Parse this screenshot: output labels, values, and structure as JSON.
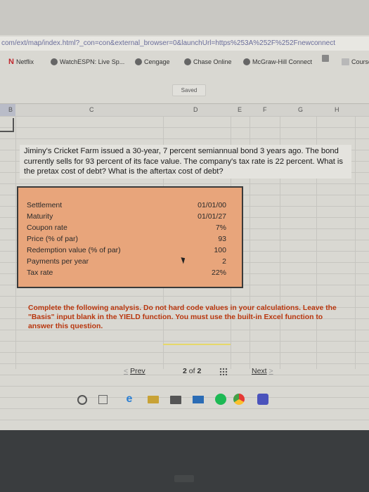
{
  "browser": {
    "url": "com/ext/map/index.html?_con=con&external_browser=0&launchUrl=https%253A%252F%252Fnewconnect",
    "bookmarks": [
      {
        "label": "Netflix",
        "icon": "netflix-icon"
      },
      {
        "label": "WatchESPN: Live Sp...",
        "icon": "globe-icon"
      },
      {
        "label": "Cengage",
        "icon": "globe-icon"
      },
      {
        "label": "Chase Online",
        "icon": "globe-icon"
      },
      {
        "label": "McGraw-Hill Connect",
        "icon": "globe-icon"
      },
      {
        "label": "",
        "icon": "mcgraw-hill-icon"
      },
      {
        "label": "Course H",
        "icon": "course-icon"
      }
    ]
  },
  "spreadsheet": {
    "status": "Saved",
    "columns": [
      "B",
      "C",
      "D",
      "E",
      "F",
      "G",
      "H"
    ]
  },
  "question": {
    "text": "Jiminy's Cricket Farm issued a 30-year, 7 percent semiannual bond 3 years ago. The bond currently sells for 93 percent of its face value. The company's tax rate is 22 percent. What is the pretax cost of debt? What is the aftertax cost of debt?"
  },
  "data_table": {
    "rows": [
      {
        "label": "Settlement",
        "value": "01/01/00"
      },
      {
        "label": "Maturity",
        "value": "01/01/27"
      },
      {
        "label": "Coupon rate",
        "value": "7%"
      },
      {
        "label": "Price (% of par)",
        "value": "93"
      },
      {
        "label": "Redemption value (% of par)",
        "value": "100"
      },
      {
        "label": "Payments per year",
        "value": "2"
      },
      {
        "label": "Tax rate",
        "value": "22%"
      }
    ]
  },
  "instructions": {
    "text": "Complete the following analysis. Do not hard code values in your calculations. Leave the \"Basis\" input blank in the YIELD function. You must use the built-in Excel function to answer this question."
  },
  "pager": {
    "prev_label": "Prev",
    "page_current": "2",
    "page_sep": "of",
    "page_total": "2",
    "next_label": "Next"
  },
  "colors": {
    "data_box_bg": "#e8a57b",
    "instruction_text": "#b8360e",
    "url_text": "#6a6d9a"
  }
}
